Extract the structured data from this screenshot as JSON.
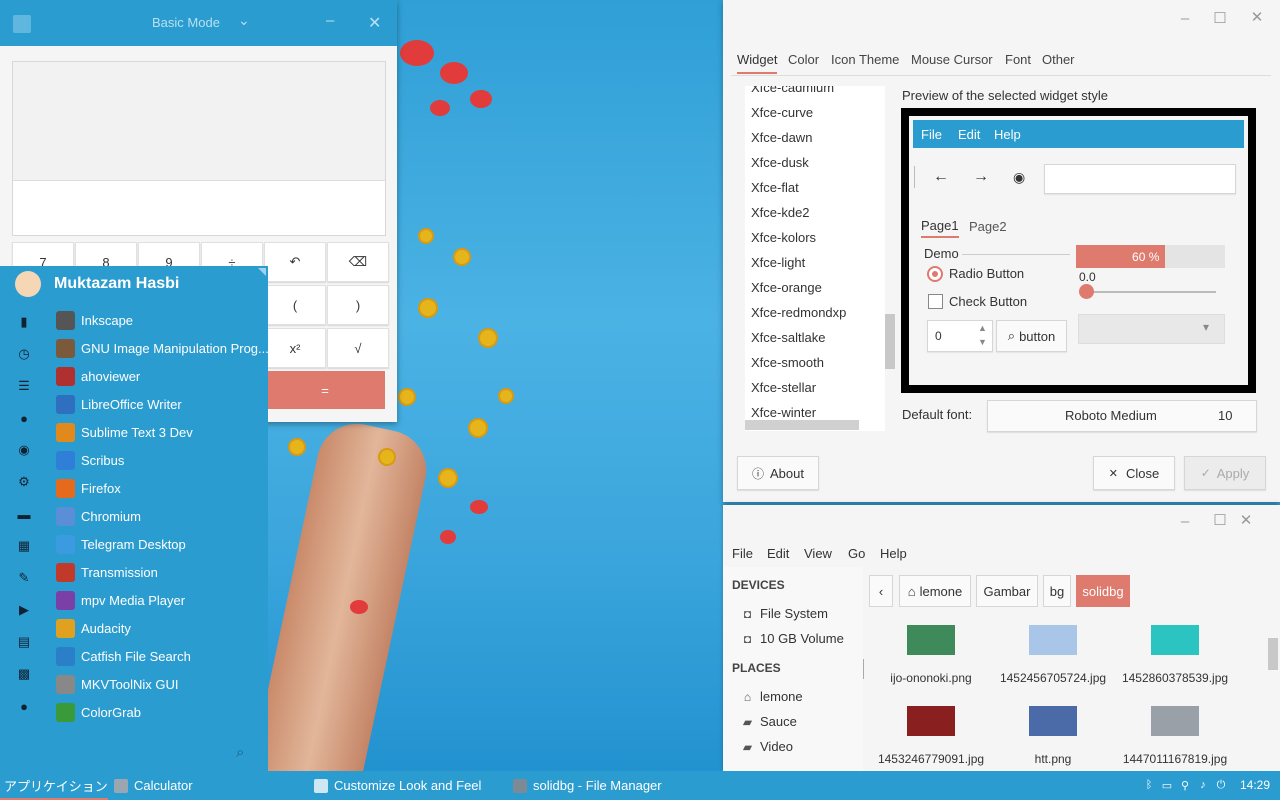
{
  "calculator": {
    "title": "Basic Mode",
    "keys_row1": [
      "7",
      "8",
      "9",
      "÷",
      "↶",
      "⌫"
    ],
    "keys_partial": [
      "(",
      ")",
      "x²",
      "√"
    ],
    "equals": "="
  },
  "menu": {
    "user": "Muktazam Hasbi",
    "apps": [
      {
        "label": "Inkscape",
        "icon": "inkscape-icon",
        "color": "#555555"
      },
      {
        "label": "GNU Image Manipulation Prog...",
        "icon": "gimp-icon",
        "color": "#7a5a3a"
      },
      {
        "label": "ahoviewer",
        "icon": "ahoviewer-icon",
        "color": "#b03030"
      },
      {
        "label": "LibreOffice Writer",
        "icon": "writer-icon",
        "color": "#2f6fc0"
      },
      {
        "label": "Sublime Text 3 Dev",
        "icon": "sublime-icon",
        "color": "#e08a1e"
      },
      {
        "label": "Scribus",
        "icon": "scribus-icon",
        "color": "#2f7fd8"
      },
      {
        "label": "Firefox",
        "icon": "firefox-icon",
        "color": "#e66a1c"
      },
      {
        "label": "Chromium",
        "icon": "chromium-icon",
        "color": "#5a8fd8"
      },
      {
        "label": "Telegram Desktop",
        "icon": "telegram-icon",
        "color": "#3a9be0"
      },
      {
        "label": "Transmission",
        "icon": "transmission-icon",
        "color": "#c0392b"
      },
      {
        "label": "mpv Media Player",
        "icon": "mpv-icon",
        "color": "#7b3fa8"
      },
      {
        "label": "Audacity",
        "icon": "audacity-icon",
        "color": "#e0a020"
      },
      {
        "label": "Catfish File Search",
        "icon": "catfish-icon",
        "color": "#2b7fc8"
      },
      {
        "label": "MKVToolNix GUI",
        "icon": "mkvtoolnix-icon",
        "color": "#888888"
      },
      {
        "label": "ColorGrab",
        "icon": "colorgrab-icon",
        "color": "#3a9a3a"
      }
    ]
  },
  "settings": {
    "tabs": [
      "Widget",
      "Color",
      "Icon Theme",
      "Mouse Cursor",
      "Font",
      "Other"
    ],
    "themes": [
      "Xfce-cadmium",
      "Xfce-curve",
      "Xfce-dawn",
      "Xfce-dusk",
      "Xfce-flat",
      "Xfce-kde2",
      "Xfce-kolors",
      "Xfce-light",
      "Xfce-orange",
      "Xfce-redmondxp",
      "Xfce-saltlake",
      "Xfce-smooth",
      "Xfce-stellar",
      "Xfce-winter"
    ],
    "preview_label": "Preview of the selected widget style",
    "preview": {
      "menu": [
        "File",
        "Edit",
        "Help"
      ],
      "tabs": [
        "Page1",
        "Page2"
      ],
      "frame_label": "Demo",
      "radio_label": "Radio Button",
      "check_label": "Check Button",
      "progress_text": "60 %",
      "progress_value": 0.6,
      "scale_value": "0.0",
      "spin_value": "0",
      "button_label": "button"
    },
    "default_font_label": "Default font:",
    "font_name": "Roboto Medium",
    "font_size": "10",
    "about": "About",
    "close": "Close",
    "apply": "Apply"
  },
  "filemanager": {
    "menu": [
      "File",
      "Edit",
      "View",
      "Go",
      "Help"
    ],
    "devices_head": "DEVICES",
    "devices": [
      "File System",
      "10 GB Volume"
    ],
    "places_head": "PLACES",
    "places": [
      "lemone",
      "Sauce",
      "Video"
    ],
    "breadcrumb": [
      "lemone",
      "Gambar",
      "bg",
      "solidbg"
    ],
    "files": [
      {
        "name": "ijo-ononoki.png",
        "color": "#3f8a5a"
      },
      {
        "name": "1452456705724.jpg",
        "color": "#a9c6e8"
      },
      {
        "name": "1452860378539.jpg",
        "color": "#2cc4c0"
      },
      {
        "name": "1453246779091.jpg",
        "color": "#8a1f1f"
      },
      {
        "name": "htt.png",
        "color": "#4a6aa8"
      },
      {
        "name": "1447011167819.jpg",
        "color": "#9aa0a8"
      }
    ]
  },
  "taskbar": {
    "apps_label": "アプリケイション",
    "tasks": [
      "Calculator",
      "Customize Look and Feel",
      "solidbg - File Manager"
    ],
    "clock": "14:29"
  }
}
